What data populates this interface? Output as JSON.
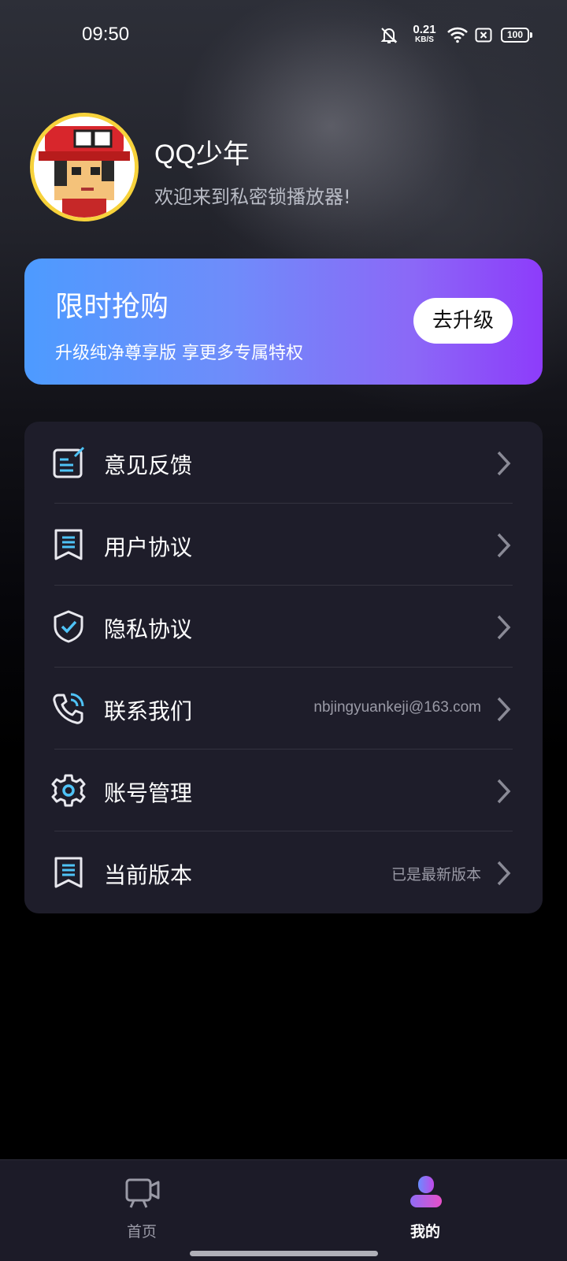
{
  "status_bar": {
    "time": "09:50",
    "net_speed_value": "0.21",
    "net_speed_unit": "KB/S",
    "battery": "100",
    "icons": [
      "bell-off-icon",
      "wifi-icon",
      "sim-off-icon",
      "battery-icon"
    ]
  },
  "profile": {
    "name": "QQ少年",
    "welcome": "欢迎来到私密锁播放器!"
  },
  "promo": {
    "title": "限时抢购",
    "subtitle": "升级纯净尊享版 享更多专属特权",
    "button": "去升级",
    "colors": [
      "#4d9bff",
      "#8d3cfa"
    ]
  },
  "menu": {
    "items": [
      {
        "label": "意见反馈",
        "value": "",
        "icon": "feedback-icon"
      },
      {
        "label": "用户协议",
        "value": "",
        "icon": "user-agreement-icon"
      },
      {
        "label": "隐私协议",
        "value": "",
        "icon": "privacy-shield-icon"
      },
      {
        "label": "联系我们",
        "value": "nbjingyuankeji@163.com",
        "icon": "phone-icon"
      },
      {
        "label": "账号管理",
        "value": "",
        "icon": "settings-gear-icon"
      },
      {
        "label": "当前版本",
        "value": "已是最新版本",
        "icon": "version-icon"
      }
    ]
  },
  "tabbar": {
    "home": "首页",
    "mine": "我的",
    "active": "mine"
  },
  "colors": {
    "accent": "#4fc3f7",
    "card_bg": "#1e1d2a"
  }
}
